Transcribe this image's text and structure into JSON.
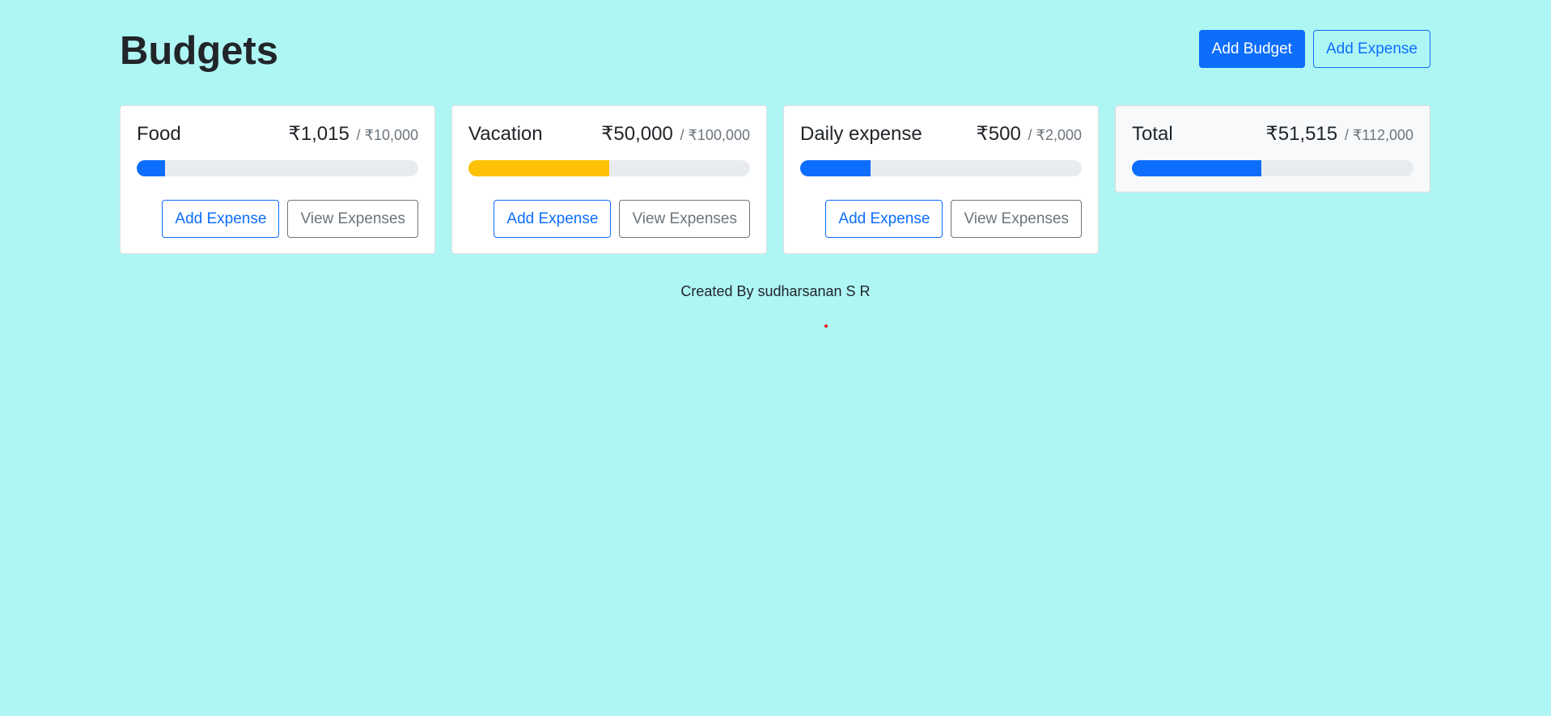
{
  "header": {
    "title": "Budgets",
    "add_budget_label": "Add Budget",
    "add_expense_label": "Add Expense"
  },
  "budgets": [
    {
      "name": "Food",
      "amount": "₹1,015",
      "max": "/ ₹10,000",
      "progress": 0.1015,
      "bar_color": "#0d6efd",
      "add_expense_label": "Add Expense",
      "view_expenses_label": "View Expenses"
    },
    {
      "name": "Vacation",
      "amount": "₹50,000",
      "max": "/ ₹100,000",
      "progress": 0.5,
      "bar_color": "#ffc107",
      "add_expense_label": "Add Expense",
      "view_expenses_label": "View Expenses"
    },
    {
      "name": "Daily expense",
      "amount": "₹500",
      "max": "/ ₹2,000",
      "progress": 0.25,
      "bar_color": "#0d6efd",
      "add_expense_label": "Add Expense",
      "view_expenses_label": "View Expenses"
    }
  ],
  "total": {
    "name": "Total",
    "amount": "₹51,515",
    "max": "/ ₹112,000",
    "progress": 0.46,
    "bar_color": "#0d6efd"
  },
  "footer": {
    "text": "Created By sudharsanan S R"
  },
  "colors": {
    "background": "#aef6f4",
    "primary": "#0d6efd",
    "warning": "#ffc107",
    "secondary": "#6c757d"
  }
}
